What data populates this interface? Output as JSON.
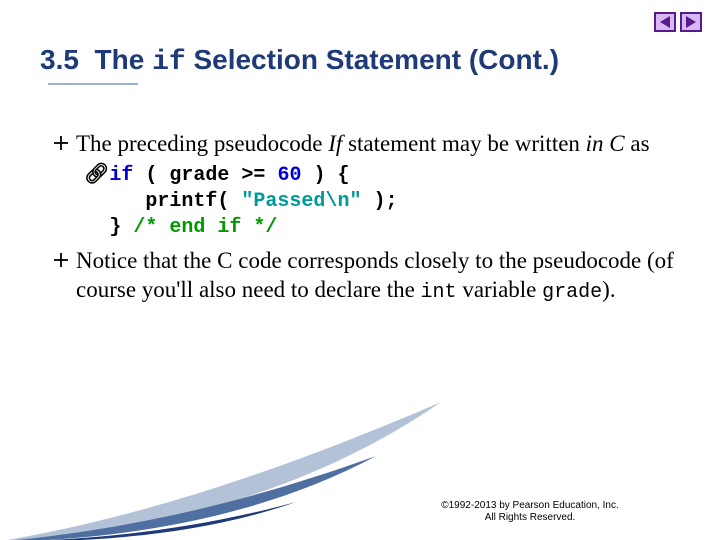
{
  "title": {
    "number": "3.5",
    "pre": "The ",
    "kw": "if",
    "post": " Selection Statement (Cont.)"
  },
  "bullets": [
    {
      "pre": "The preceding pseudocode ",
      "ital1": "If",
      "mid": " statement may be written ",
      "ital2": "in C",
      "post": " as"
    },
    {
      "plain1": "Notice that the C code corresponds closely to the pseudocode (of course you'll also need to declare the ",
      "mono1": "int",
      "plain2": " variable ",
      "mono2": "grade",
      "plain3": ")."
    }
  ],
  "code": {
    "l1_kw": "if",
    "l1_rest": " ( grade >= ",
    "l1_num": "60",
    "l1_tail": " ) {",
    "l2_pre": "   printf( ",
    "l2_str": "\"Passed\\n\"",
    "l2_post": " );",
    "l3_pre": "} ",
    "l3_cmt": "/* end if */"
  },
  "copyright": {
    "line1": "©1992-2013 by Pearson Education, Inc.",
    "line2": "All Rights Reserved."
  }
}
